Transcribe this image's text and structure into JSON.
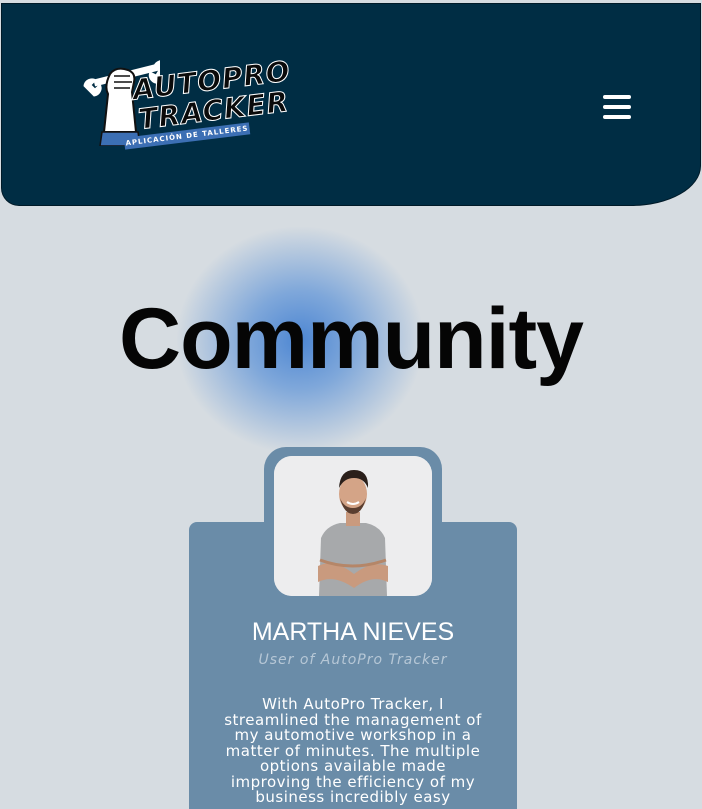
{
  "header": {
    "logo": {
      "line1": "AUTOPRO",
      "line2": "TRACKER",
      "tagline": "APLICACIÓN DE TALLERES"
    },
    "menu_icon": "hamburger-menu-icon"
  },
  "main": {
    "title": "Community"
  },
  "testimonial": {
    "name": "MARTHA NIEVES",
    "role": "User of AutoPro Tracker",
    "quote": "With AutoPro Tracker, I streamlined the management of my automotive workshop in a matter of minutes. The multiple options available made improving the efficiency of my business incredibly easy"
  },
  "colors": {
    "header_bg": "#002d44",
    "page_bg": "#d6dce1",
    "card_bg": "#6a8ca8",
    "accent_blue": "#3c6fb4"
  }
}
